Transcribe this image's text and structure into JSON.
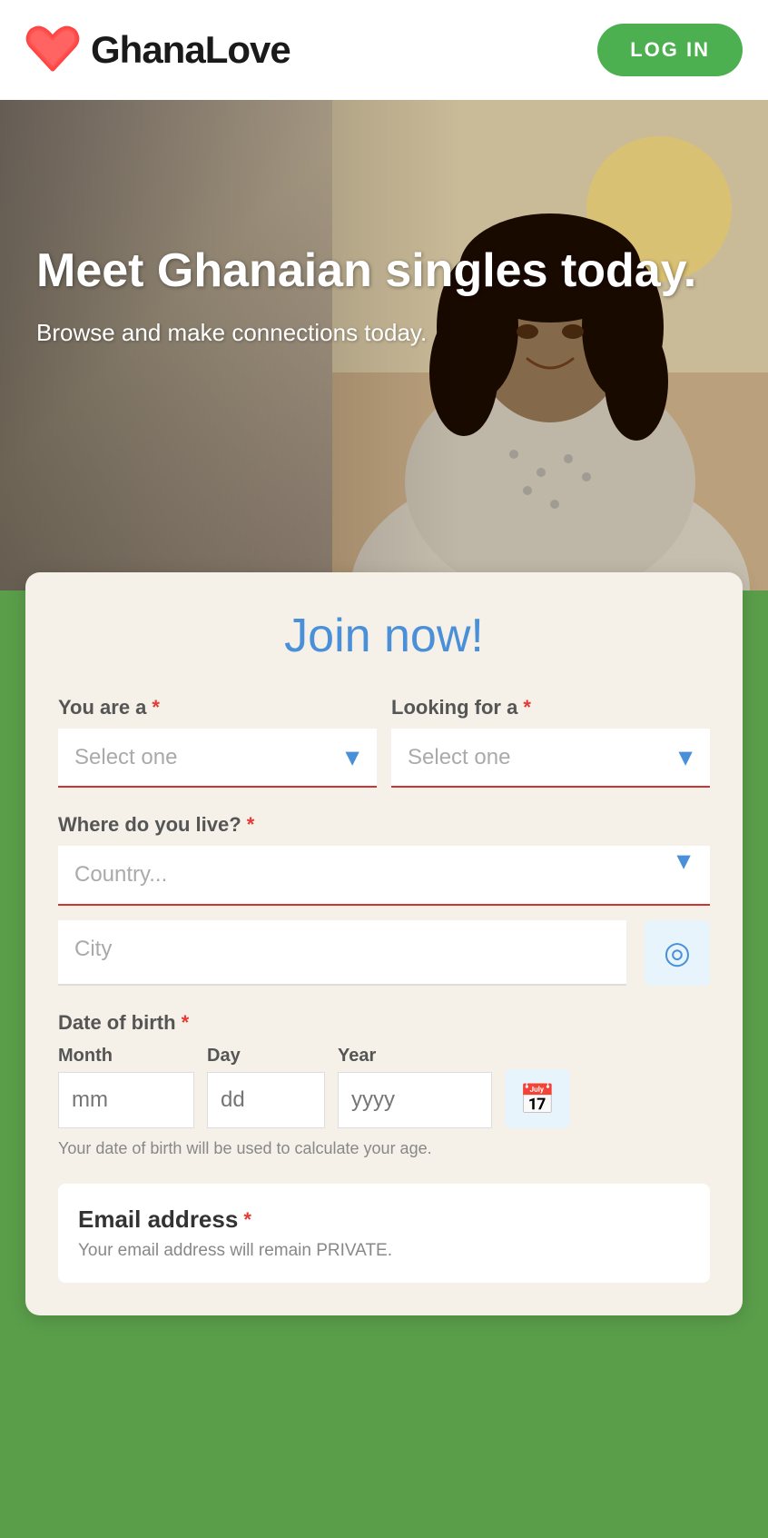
{
  "header": {
    "logo_text": "GhanaLove",
    "login_label": "LOG IN"
  },
  "hero": {
    "title": "Meet Ghanaian singles today.",
    "subtitle": "Browse and make connections today."
  },
  "form": {
    "title": "Join now!",
    "you_are_label": "You are a",
    "looking_for_label": "Looking for a",
    "you_are_placeholder": "Select one",
    "looking_for_placeholder": "Select one",
    "where_live_label": "Where do you live?",
    "country_placeholder": "Country...",
    "city_placeholder": "City",
    "dob_label": "Date of birth",
    "month_label": "Month",
    "day_label": "Day",
    "year_label": "Year",
    "month_placeholder": "mm",
    "day_placeholder": "dd",
    "year_placeholder": "yyyy",
    "dob_hint": "Your date of birth will be used to calculate your age.",
    "email_label": "Email address",
    "email_hint": "Your email address will remain PRIVATE.",
    "required_symbol": "*"
  }
}
